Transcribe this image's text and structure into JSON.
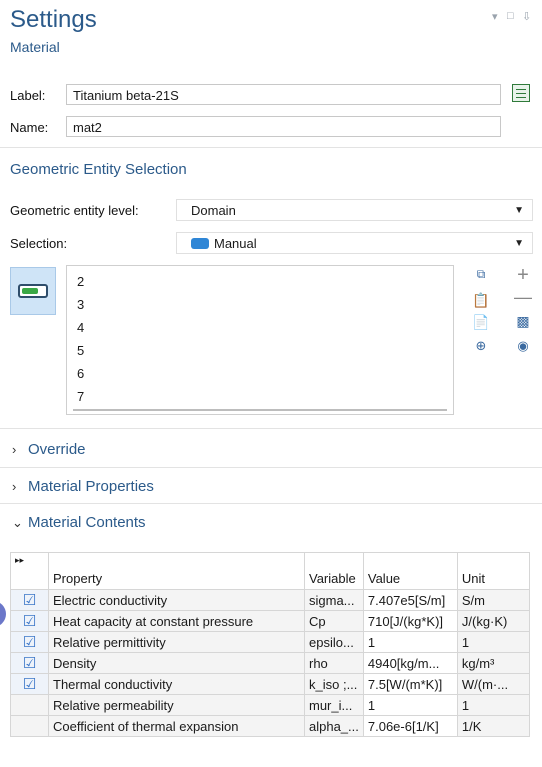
{
  "header": {
    "title": "Settings",
    "subtitle": "Material",
    "window_controls": [
      "▾",
      "□",
      "⇩"
    ]
  },
  "label_field": {
    "label": "Label:",
    "value": "Titanium beta-21S"
  },
  "name_field": {
    "label": "Name:",
    "value": "mat2"
  },
  "geometric": {
    "section_title": "Geometric Entity Selection",
    "level_label": "Geometric entity level:",
    "level_value": "Domain",
    "selection_label": "Selection:",
    "selection_value": "Manual",
    "items": [
      "2",
      "3",
      "4",
      "5",
      "6",
      "7"
    ]
  },
  "sections": {
    "override": "Override",
    "material_properties": "Material Properties",
    "material_contents": "Material Contents"
  },
  "table": {
    "headers": {
      "expand": "▸▸",
      "property": "Property",
      "variable": "Variable",
      "value": "Value",
      "unit": "Unit"
    },
    "rows": [
      {
        "checked": true,
        "property": "Electric conductivity",
        "variable": "sigma...",
        "value": "7.407e5[S/m]",
        "unit": "S/m"
      },
      {
        "checked": true,
        "property": "Heat capacity at constant pressure",
        "variable": "Cp",
        "value": "710[J/(kg*K)]",
        "unit": "J/(kg·K)"
      },
      {
        "checked": true,
        "property": "Relative permittivity",
        "variable": "epsilo...",
        "value": "1",
        "unit": "1"
      },
      {
        "checked": true,
        "property": "Density",
        "variable": "rho",
        "value": "4940[kg/m...",
        "unit": "kg/m³"
      },
      {
        "checked": true,
        "property": "Thermal conductivity",
        "variable": "k_iso ;...",
        "value": "7.5[W/(m*K)]",
        "unit": "W/(m·..."
      },
      {
        "checked": false,
        "property": "Relative permeability",
        "variable": "mur_i...",
        "value": "1",
        "unit": "1"
      },
      {
        "checked": false,
        "property": "Coefficient of thermal expansion",
        "variable": "alpha_...",
        "value": "7.06e-6[1/K]",
        "unit": "1/K"
      }
    ]
  },
  "colors": {
    "accent": "#2b5a8a",
    "check": "#3a76c8",
    "toggle_green": "#3aa845"
  }
}
